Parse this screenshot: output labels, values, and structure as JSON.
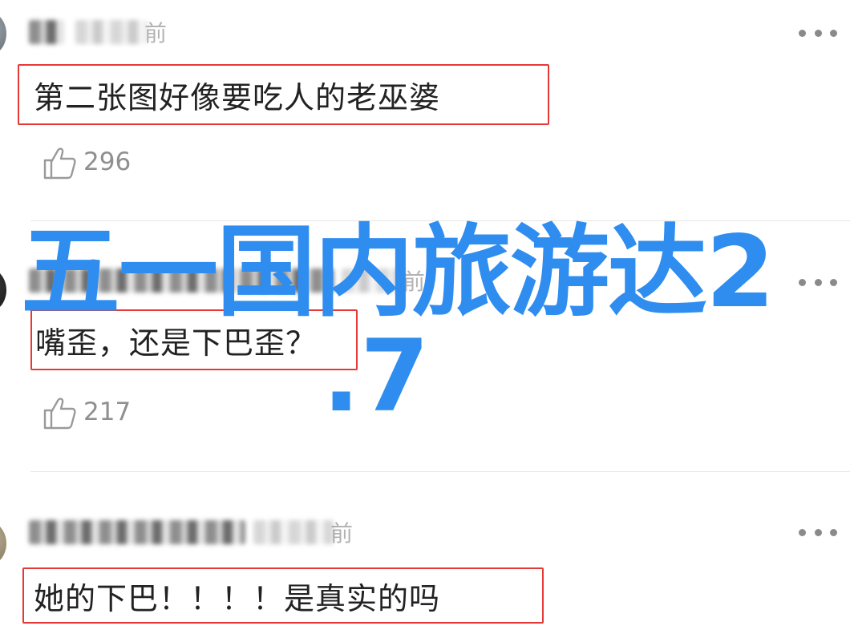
{
  "comments": [
    {
      "time_suffix": "前",
      "text": "第二张图好像要吃人的老巫婆",
      "likes": "296"
    },
    {
      "time_suffix": "前",
      "text": "嘴歪，还是下巴歪？",
      "likes": "217"
    },
    {
      "time_suffix": "前",
      "text": "她的下巴！！！！是真实的吗"
    }
  ],
  "watermark": {
    "line1": "五一国内旅游达2",
    "line2": ".7",
    "color": "#2f8df0"
  },
  "highlight_color": "#e53935",
  "icons": {
    "more": "more-horizontal-icon",
    "like": "thumbs-up-icon"
  }
}
